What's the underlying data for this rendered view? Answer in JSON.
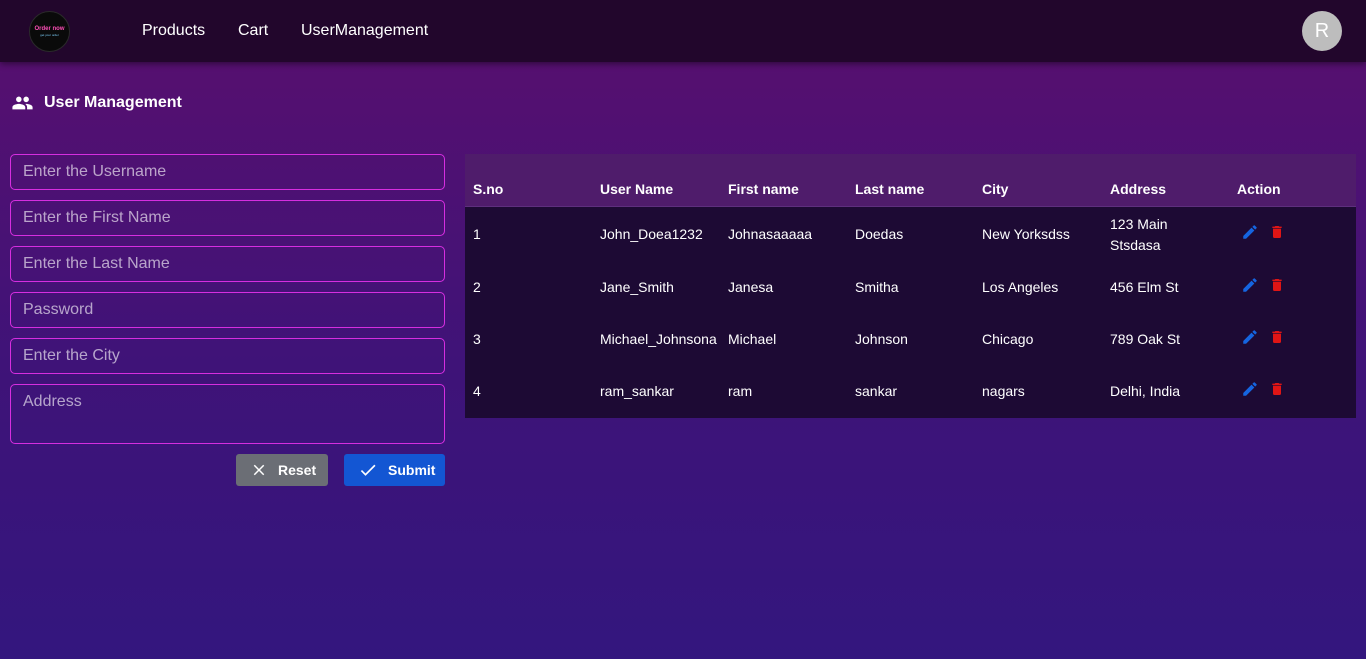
{
  "nav": {
    "logo_text": "Order now",
    "logo_sub": "get your order",
    "links": [
      "Products",
      "Cart",
      "UserManagement"
    ],
    "avatar_initial": "R"
  },
  "page": {
    "title": "User Management",
    "title_icon": "people-icon"
  },
  "form": {
    "username_placeholder": "Enter the Username",
    "firstname_placeholder": "Enter the First Name",
    "lastname_placeholder": "Enter the Last Name",
    "password_placeholder": "Password",
    "city_placeholder": "Enter the City",
    "address_placeholder": "Address",
    "reset_label": "Reset",
    "submit_label": "Submit"
  },
  "table": {
    "headers": [
      "S.no",
      "User Name",
      "First name",
      "Last name",
      "City",
      "Address",
      "Action"
    ],
    "rows": [
      {
        "sno": "1",
        "username": "John_Doea1232",
        "first": "Johnasaaaaa",
        "last": "Doedas",
        "city": "New Yorksdss",
        "address_line1": "123 Main",
        "address_line2": "Stsdasa"
      },
      {
        "sno": "2",
        "username": "Jane_Smith",
        "first": "Janesa",
        "last": "Smitha",
        "city": "Los Angeles",
        "address_line1": "456 Elm St",
        "address_line2": ""
      },
      {
        "sno": "3",
        "username": "Michael_Johnsona",
        "first": "Michael",
        "last": "Johnson",
        "city": "Chicago",
        "address_line1": "789 Oak St",
        "address_line2": ""
      },
      {
        "sno": "4",
        "username": "ram_sankar",
        "first": "ram",
        "last": "sankar",
        "city": "nagars",
        "address_line1": "Delhi, India",
        "address_line2": ""
      }
    ]
  },
  "colors": {
    "nav_bg": "#22062c",
    "field_border": "#d62ee0",
    "submit_bg": "#1356d3",
    "reset_bg": "#6b6e75",
    "edit_icon": "#1565e0",
    "delete_icon": "#e01515"
  }
}
